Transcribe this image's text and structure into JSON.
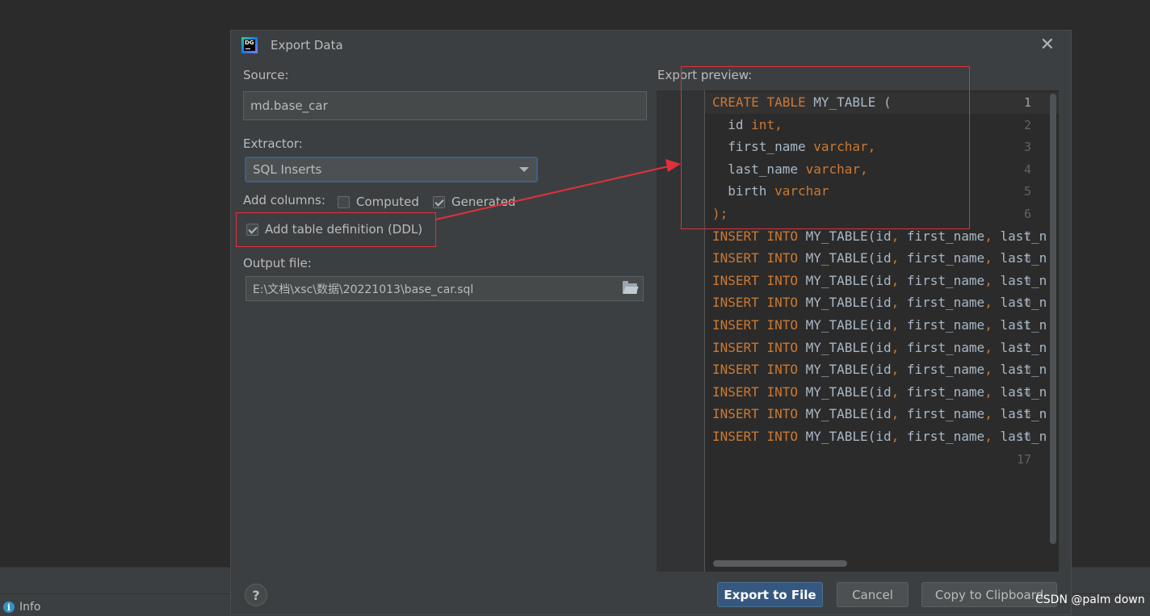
{
  "status_bar": {
    "info_label": "Info",
    "info_icon": "info-icon"
  },
  "dialog": {
    "title": "Export Data",
    "close_icon": "close-icon",
    "source_label": "Source:",
    "source_value": "md.base_car",
    "extractor_label": "Extractor:",
    "extractor_value": "SQL Inserts",
    "add_columns_label": "Add columns:",
    "computed_label": "Computed",
    "computed_checked": false,
    "generated_label": "Generated",
    "generated_checked": true,
    "ddl_label": "Add table definition (DDL)",
    "ddl_checked": true,
    "output_file_label": "Output file:",
    "output_file_value": "E:\\文档\\xsc\\数据\\20221013\\base_car.sql",
    "preview_label": "Export preview:",
    "preview_lines": [
      {
        "n": "1",
        "code": "CREATE TABLE MY_TABLE ("
      },
      {
        "n": "2",
        "code": "  id int,"
      },
      {
        "n": "3",
        "code": "  first_name varchar,"
      },
      {
        "n": "4",
        "code": "  last_name varchar,"
      },
      {
        "n": "5",
        "code": "  birth varchar"
      },
      {
        "n": "6",
        "code": ");"
      },
      {
        "n": "7",
        "code": "INSERT INTO MY_TABLE(id, first_name, last_n"
      },
      {
        "n": "8",
        "code": "INSERT INTO MY_TABLE(id, first_name, last_n"
      },
      {
        "n": "9",
        "code": "INSERT INTO MY_TABLE(id, first_name, last_n"
      },
      {
        "n": "10",
        "code": "INSERT INTO MY_TABLE(id, first_name, last_n"
      },
      {
        "n": "11",
        "code": "INSERT INTO MY_TABLE(id, first_name, last_n"
      },
      {
        "n": "12",
        "code": "INSERT INTO MY_TABLE(id, first_name, last_n"
      },
      {
        "n": "13",
        "code": "INSERT INTO MY_TABLE(id, first_name, last_n"
      },
      {
        "n": "14",
        "code": "INSERT INTO MY_TABLE(id, first_name, last_n"
      },
      {
        "n": "15",
        "code": "INSERT INTO MY_TABLE(id, first_name, last_n"
      },
      {
        "n": "16",
        "code": "INSERT INTO MY_TABLE(id, first_name, last_n"
      },
      {
        "n": "17",
        "code": ""
      }
    ],
    "help_label": "?",
    "export_button": "Export to File",
    "cancel_button": "Cancel",
    "copy_button": "Copy to Clipboard"
  },
  "watermark": "CSDN @palm down",
  "colors": {
    "keyword": "#cc7832",
    "identifier": "#a9b7c6",
    "annotation_red": "#e0313a",
    "primary_button": "#365880"
  }
}
